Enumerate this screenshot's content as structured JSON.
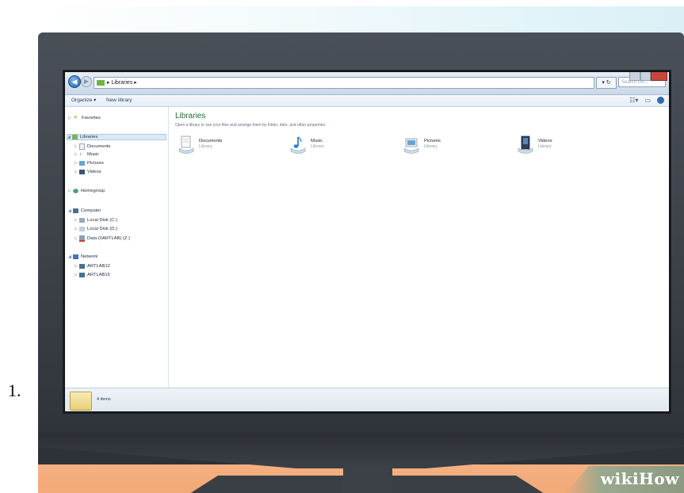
{
  "step_number": "1.",
  "watermark": "wikiHow",
  "explorer": {
    "address_path": "Libraries",
    "search_placeholder": "Search Lib...",
    "toolbar": {
      "organize": "Organize ▾",
      "new_library": "New library"
    },
    "nav": {
      "favorites": "Favorites",
      "libraries": "Libraries",
      "documents": "Documents",
      "music": "Music",
      "pictures": "Pictures",
      "videos": "Videos",
      "homegroup": "Homegroup",
      "computer": "Computer",
      "local_disk_c": "Local Disk (C:)",
      "local_disk_d": "Local Disk (D:)",
      "data_drive": "Data (\\\\ARTLAB) (Z:)",
      "network": "Network",
      "artlab12": "ARTLAB12",
      "artlab15": "ARTLAB15"
    },
    "content": {
      "title": "Libraries",
      "subtitle": "Open a library to see your files and arrange them by folder, date, and other properties.",
      "libraries": [
        {
          "name": "Documents",
          "type": "Library"
        },
        {
          "name": "Music",
          "type": "Library"
        },
        {
          "name": "Pictures",
          "type": "Library"
        },
        {
          "name": "Videos",
          "type": "Library"
        }
      ]
    },
    "status": "4 items"
  },
  "colors": {
    "accent_title": "#1f6a2d",
    "floor": "#f3a877",
    "monitor": "#3a3f46"
  }
}
